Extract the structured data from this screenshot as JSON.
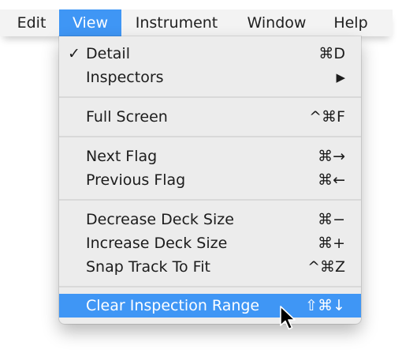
{
  "menubar": {
    "items": [
      {
        "label": "Edit"
      },
      {
        "label": "View",
        "active": true
      },
      {
        "label": "Instrument"
      },
      {
        "label": "Window"
      },
      {
        "label": "Help"
      }
    ]
  },
  "view_menu": {
    "items": [
      {
        "label": "Detail",
        "checked": true,
        "check_mark": "✓",
        "shortcut": "⌘D"
      },
      {
        "label": "Inspectors",
        "shortcut": "▶",
        "submenu": true
      },
      {
        "label": "Full Screen",
        "shortcut": "^⌘F"
      },
      {
        "label": "Next Flag",
        "shortcut": "⌘→"
      },
      {
        "label": "Previous Flag",
        "shortcut": "⌘←"
      },
      {
        "label": "Decrease Deck Size",
        "shortcut": "⌘−"
      },
      {
        "label": "Increase Deck Size",
        "shortcut": "⌘+"
      },
      {
        "label": "Snap Track To Fit",
        "shortcut": "^⌘Z"
      },
      {
        "label": "Clear Inspection Range",
        "shortcut": "⇧⌘↓",
        "highlighted": true
      }
    ]
  },
  "colors": {
    "highlight": "#3f96f5",
    "menu_background": "#ececec",
    "menubar_background": "#f3f3f3"
  },
  "icons": {
    "pointer": "arrow-cursor-icon",
    "submenu": "triangle-right-icon",
    "check": "checkmark-icon"
  }
}
